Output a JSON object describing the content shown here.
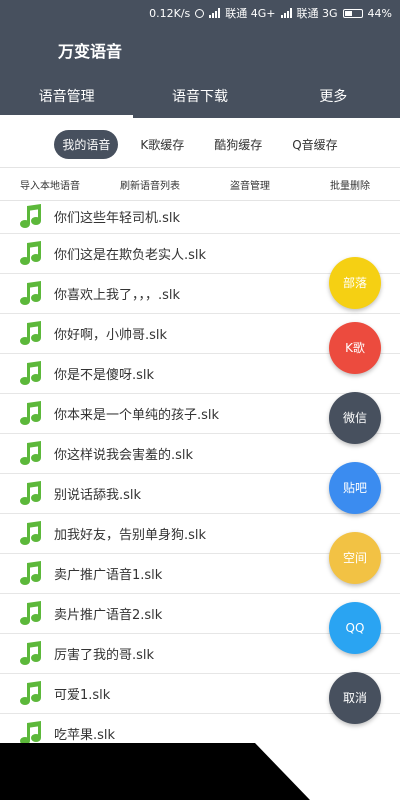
{
  "status_bar": {
    "speed": "0.12K/s",
    "carrier1": "联通 4G+",
    "carrier2": "联通 3G",
    "battery": "44%"
  },
  "header": {
    "app_title": "万变语音",
    "tabs": [
      {
        "label": "语音管理",
        "active": true
      },
      {
        "label": "语音下载",
        "active": false
      },
      {
        "label": "更多",
        "active": false
      }
    ]
  },
  "subtabs": [
    {
      "label": "我的语音",
      "active": true
    },
    {
      "label": "K歌缓存",
      "active": false
    },
    {
      "label": "酷狗缓存",
      "active": false
    },
    {
      "label": "Q音缓存",
      "active": false
    }
  ],
  "actions": [
    {
      "label": "导入本地语音"
    },
    {
      "label": "刷新语音列表"
    },
    {
      "label": "盗音管理"
    },
    {
      "label": "批量删除"
    }
  ],
  "files": [
    "你们这些年轻司机.slk",
    "你们这是在欺负老实人.slk",
    "你喜欢上我了，，，.slk",
    "你好啊，小帅哥.slk",
    "你是不是傻呀.slk",
    "你本来是一个单纯的孩子.slk",
    "你这样说我会害羞的.slk",
    "别说话舔我.slk",
    "加我好友，告别单身狗.slk",
    "卖广推广语音1.slk",
    "卖片推广语音2.slk",
    "厉害了我的哥.slk",
    "可爱1.slk",
    "吃苹果.slk"
  ],
  "share_buttons": [
    {
      "label": "部落",
      "color": "#f5d013"
    },
    {
      "label": "K歌",
      "color": "#ec4b3e"
    },
    {
      "label": "微信",
      "color": "#47505e"
    },
    {
      "label": "贴吧",
      "color": "#3b8cf0"
    },
    {
      "label": "空间",
      "color": "#f2c244"
    },
    {
      "label": "QQ",
      "color": "#2aa4f2"
    },
    {
      "label": "取消",
      "color": "#47505e"
    }
  ],
  "colors": {
    "header_bg": "#47505e",
    "note_icon": "#5cb83a"
  }
}
